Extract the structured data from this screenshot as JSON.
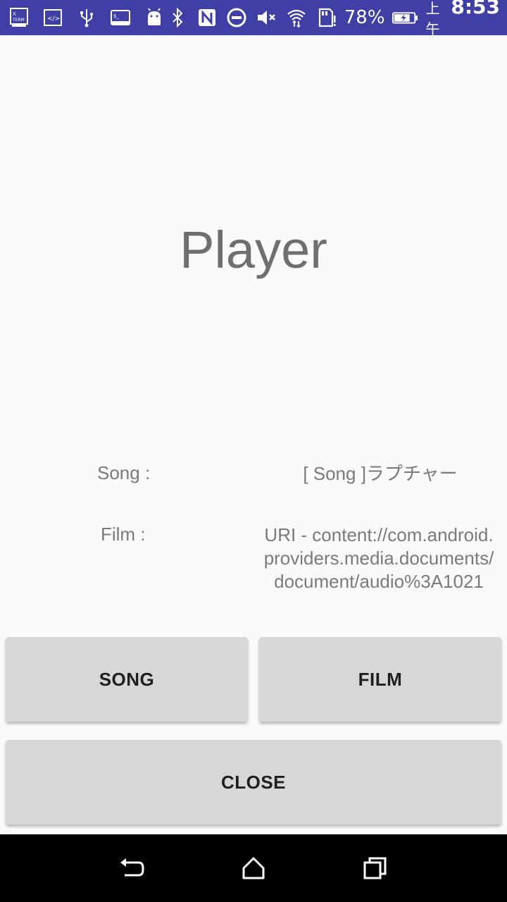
{
  "status_bar": {
    "battery_percent": "78%",
    "time_prefix": "上午",
    "time": "8:53",
    "icons_left": [
      "xterm-icon",
      "code-icon",
      "usb-icon",
      "terminal-icon",
      "android-icon"
    ],
    "icons_right": [
      "bluetooth-icon",
      "nfc-icon",
      "dnd-icon",
      "mute-icon",
      "wifi-icon",
      "sd-card-icon",
      "battery-icon"
    ]
  },
  "main": {
    "title": "Player",
    "song_label": "Song :",
    "song_value": "[ Song ]ラプチャー",
    "film_label": "Film :",
    "film_value_lines": [
      "URI - content://com.android.",
      "providers.media.documents/",
      "document/audio%3A1021"
    ]
  },
  "buttons": {
    "song": "SONG",
    "film": "FILM",
    "close": "CLOSE"
  },
  "nav": [
    "back-icon",
    "home-icon",
    "recents-icon"
  ]
}
